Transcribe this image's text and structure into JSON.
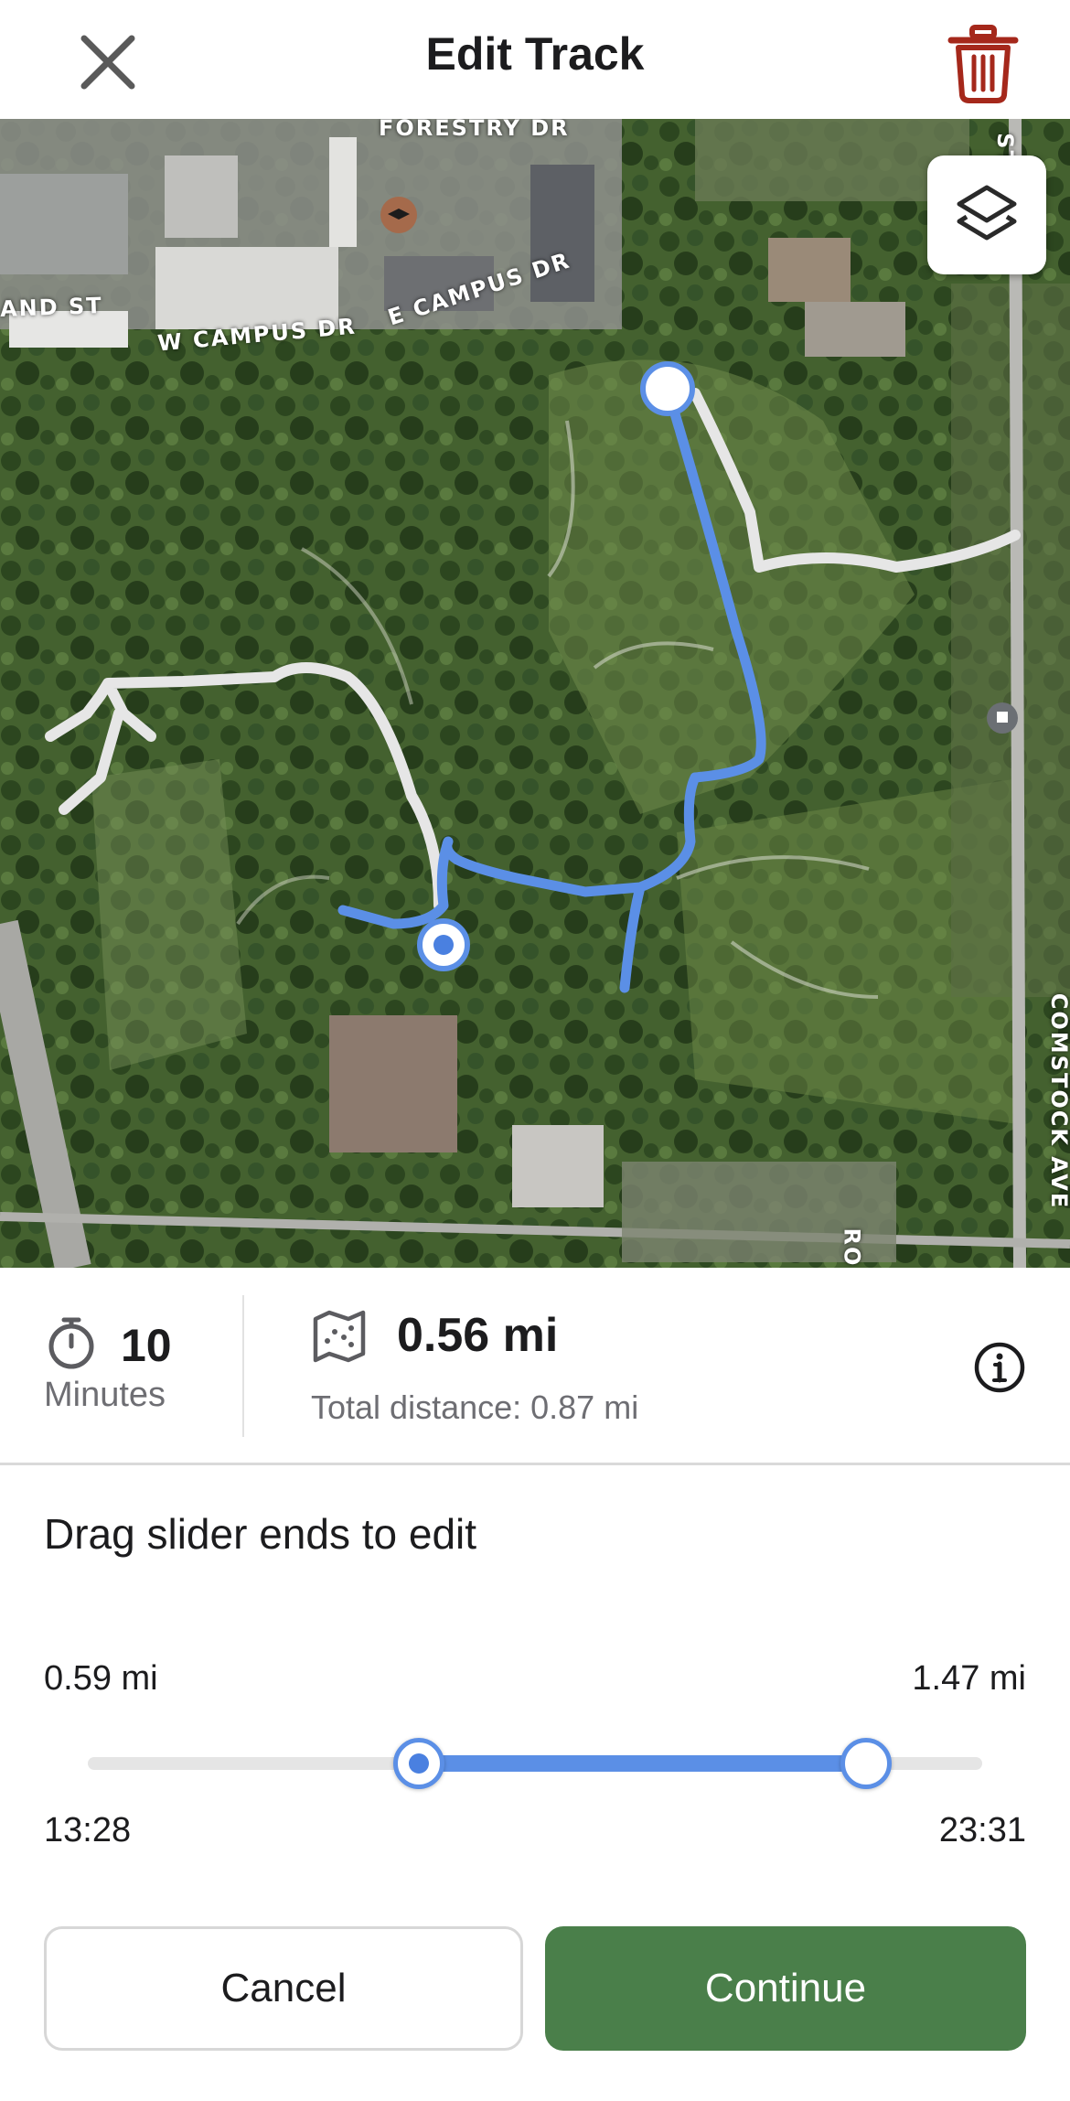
{
  "header": {
    "title": "Edit Track",
    "close_icon": "close-icon",
    "delete_icon": "trash-icon",
    "delete_color": "#a5281b"
  },
  "map": {
    "streets": {
      "forestry": "FORESTRY DR",
      "land_st": "AND ST",
      "w_campus": "W CAMPUS DR",
      "e_campus": "E CAMPUS DR",
      "comstock": "COMSTOCK AVE",
      "st": "ST",
      "ro": "RO"
    },
    "layers_icon": "layers-icon",
    "route_color": "#5b8fe6",
    "trail_color": "#e6e6e6"
  },
  "stats": {
    "time_value": "10",
    "time_unit": "Minutes",
    "distance_value": "0.56 mi",
    "total_distance": "Total distance: 0.87 mi"
  },
  "editor": {
    "hint": "Drag slider ends to edit",
    "start_distance": "0.59 mi",
    "end_distance": "1.47 mi",
    "start_time": "13:28",
    "end_time": "23:31",
    "range_start_fraction": 0.37,
    "range_end_fraction": 0.87
  },
  "actions": {
    "cancel": "Cancel",
    "continue": "Continue",
    "accent": "#4a7f4a"
  }
}
